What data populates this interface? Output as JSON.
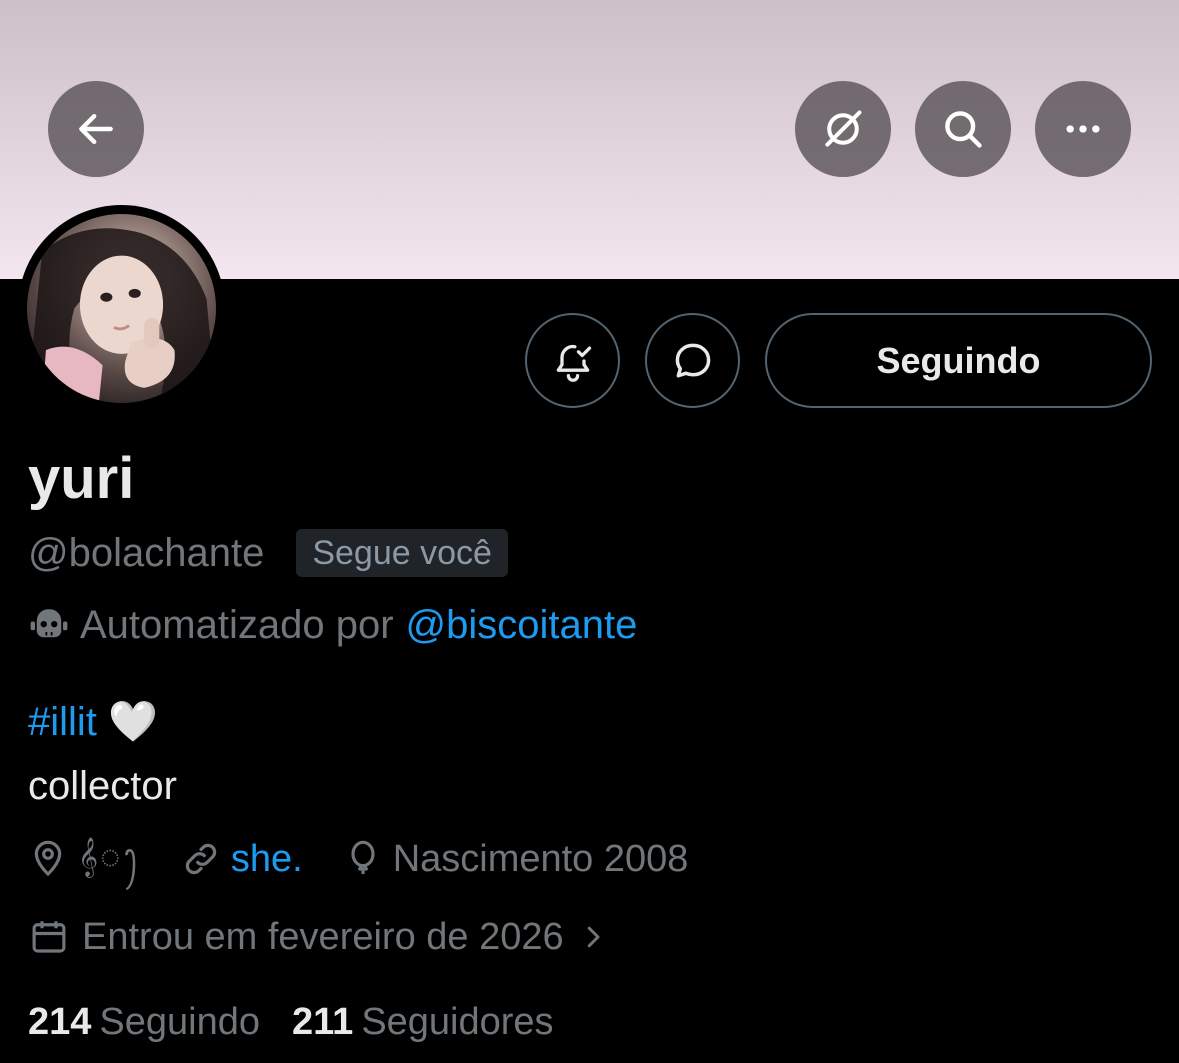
{
  "header": {
    "back_icon": "arrow-left-icon",
    "grok_icon": "grok-icon",
    "search_icon": "search-icon",
    "more_icon": "more-horizontal-icon",
    "banner_colors": [
      "#cdbfc7",
      "#f3e6ee"
    ]
  },
  "profile": {
    "display_name": "yuri",
    "handle": "@bolachante",
    "follows_you_badge": "Segue você",
    "automated_prefix": "Automatizado por",
    "automated_by": "@biscoitante",
    "bio_hashtag": "#illit",
    "bio_heart": "🤍",
    "bio_line2": "collector",
    "location": "𝄞◌ꫂ",
    "website": "she.",
    "birth": "Nascimento 2008",
    "joined": "Entrou em fevereiro de 2026"
  },
  "actions": {
    "notify_icon": "bell-check-icon",
    "dm_icon": "message-icon",
    "following_label": "Seguindo"
  },
  "stats": {
    "following_count": "214",
    "following_label": "Seguindo",
    "followers_count": "211",
    "followers_label": "Seguidores"
  },
  "colors": {
    "accent": "#1d9bf0",
    "secondary_text": "#71767b",
    "primary_text": "#e7e9ea",
    "border": "#536471"
  }
}
